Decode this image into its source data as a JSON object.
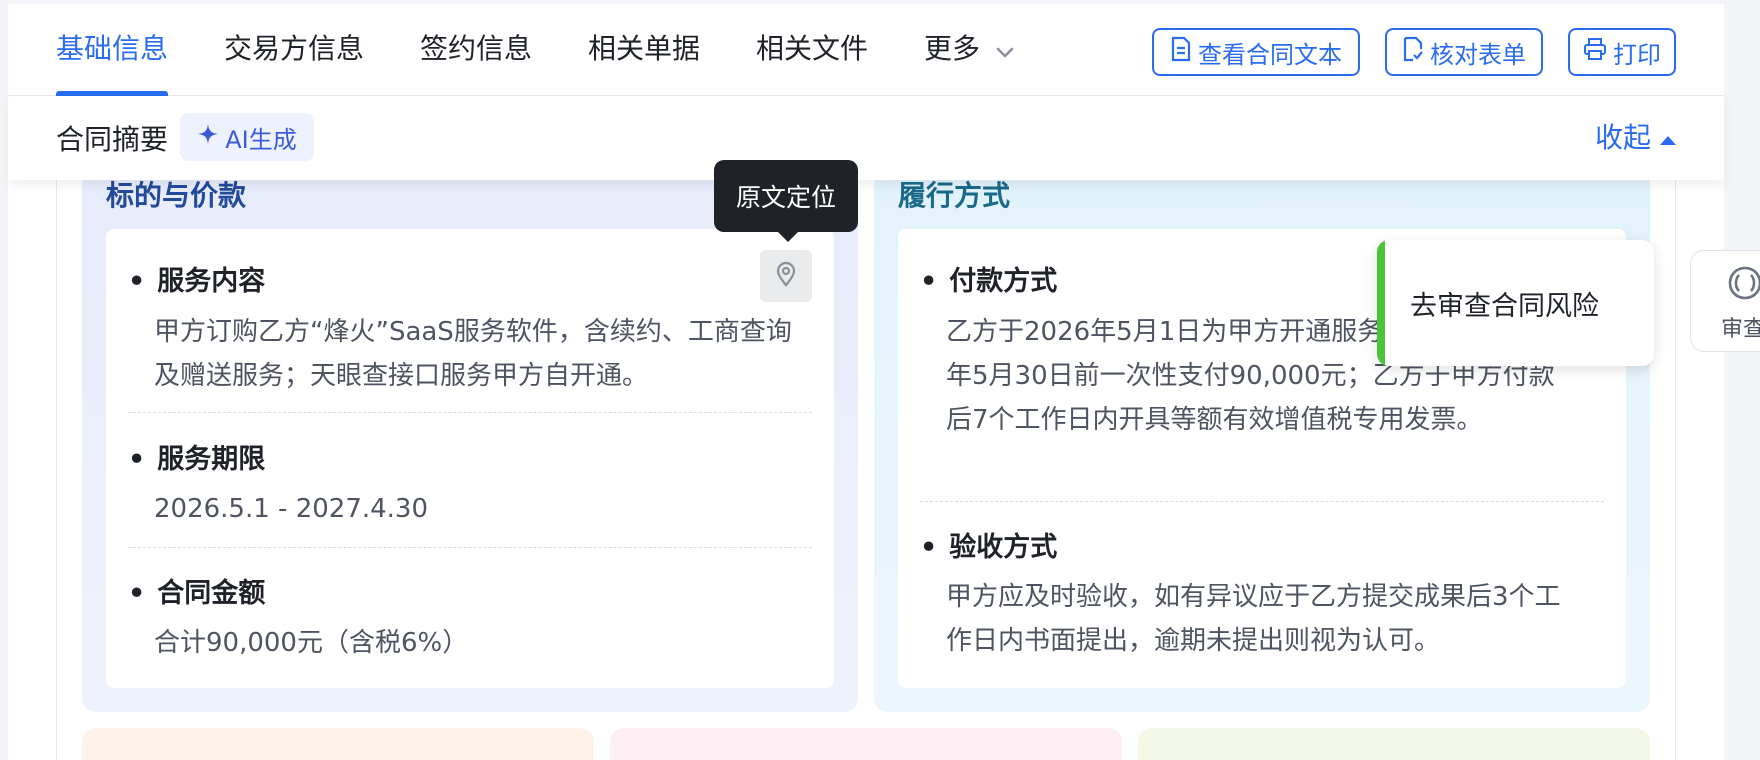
{
  "tabs": [
    {
      "label": "基础信息",
      "active": true
    },
    {
      "label": "交易方信息",
      "active": false
    },
    {
      "label": "签约信息",
      "active": false
    },
    {
      "label": "相关单据",
      "active": false
    },
    {
      "label": "相关文件",
      "active": false
    },
    {
      "label": "更多",
      "active": false
    }
  ],
  "actions": {
    "view_contract": "查看合同文本",
    "verify_form": "核对表单",
    "print": "打印"
  },
  "summary": {
    "title": "合同摘要",
    "ai_badge": "AI生成",
    "collapse": "收起"
  },
  "left_section": {
    "title": "标的与价款",
    "items": [
      {
        "title": "服务内容",
        "text": "甲方订购乙方“烽火”SaaS服务软件，含续约、工商查询及赠送服务；天眼查接口服务甲方自开通。"
      },
      {
        "title": "服务期限",
        "text": "2026.5.1 - 2027.4.30"
      },
      {
        "title": "合同金额",
        "text": "合计90,000元（含税6%）"
      }
    ]
  },
  "right_section": {
    "title": "履行方式",
    "items": [
      {
        "title": "付款方式",
        "text": "乙方于2026年5月1日为甲方开通服务，甲方于2026年5月30日前一次性支付90,000元；乙方于甲方付款后7个工作日内开具等额有效增值税专用发票。"
      },
      {
        "title": "验收方式",
        "text": "甲方应及时验收，如有异议应于乙方提交成果后3个工作日内书面提出，逾期未提出则视为认可。"
      }
    ]
  },
  "tooltip": "原文定位",
  "risk_popover": "去审查合同风险",
  "review_float": "审查",
  "colors": {
    "accent": "#2a6cf0",
    "risk_bar": "#4cc43a"
  }
}
